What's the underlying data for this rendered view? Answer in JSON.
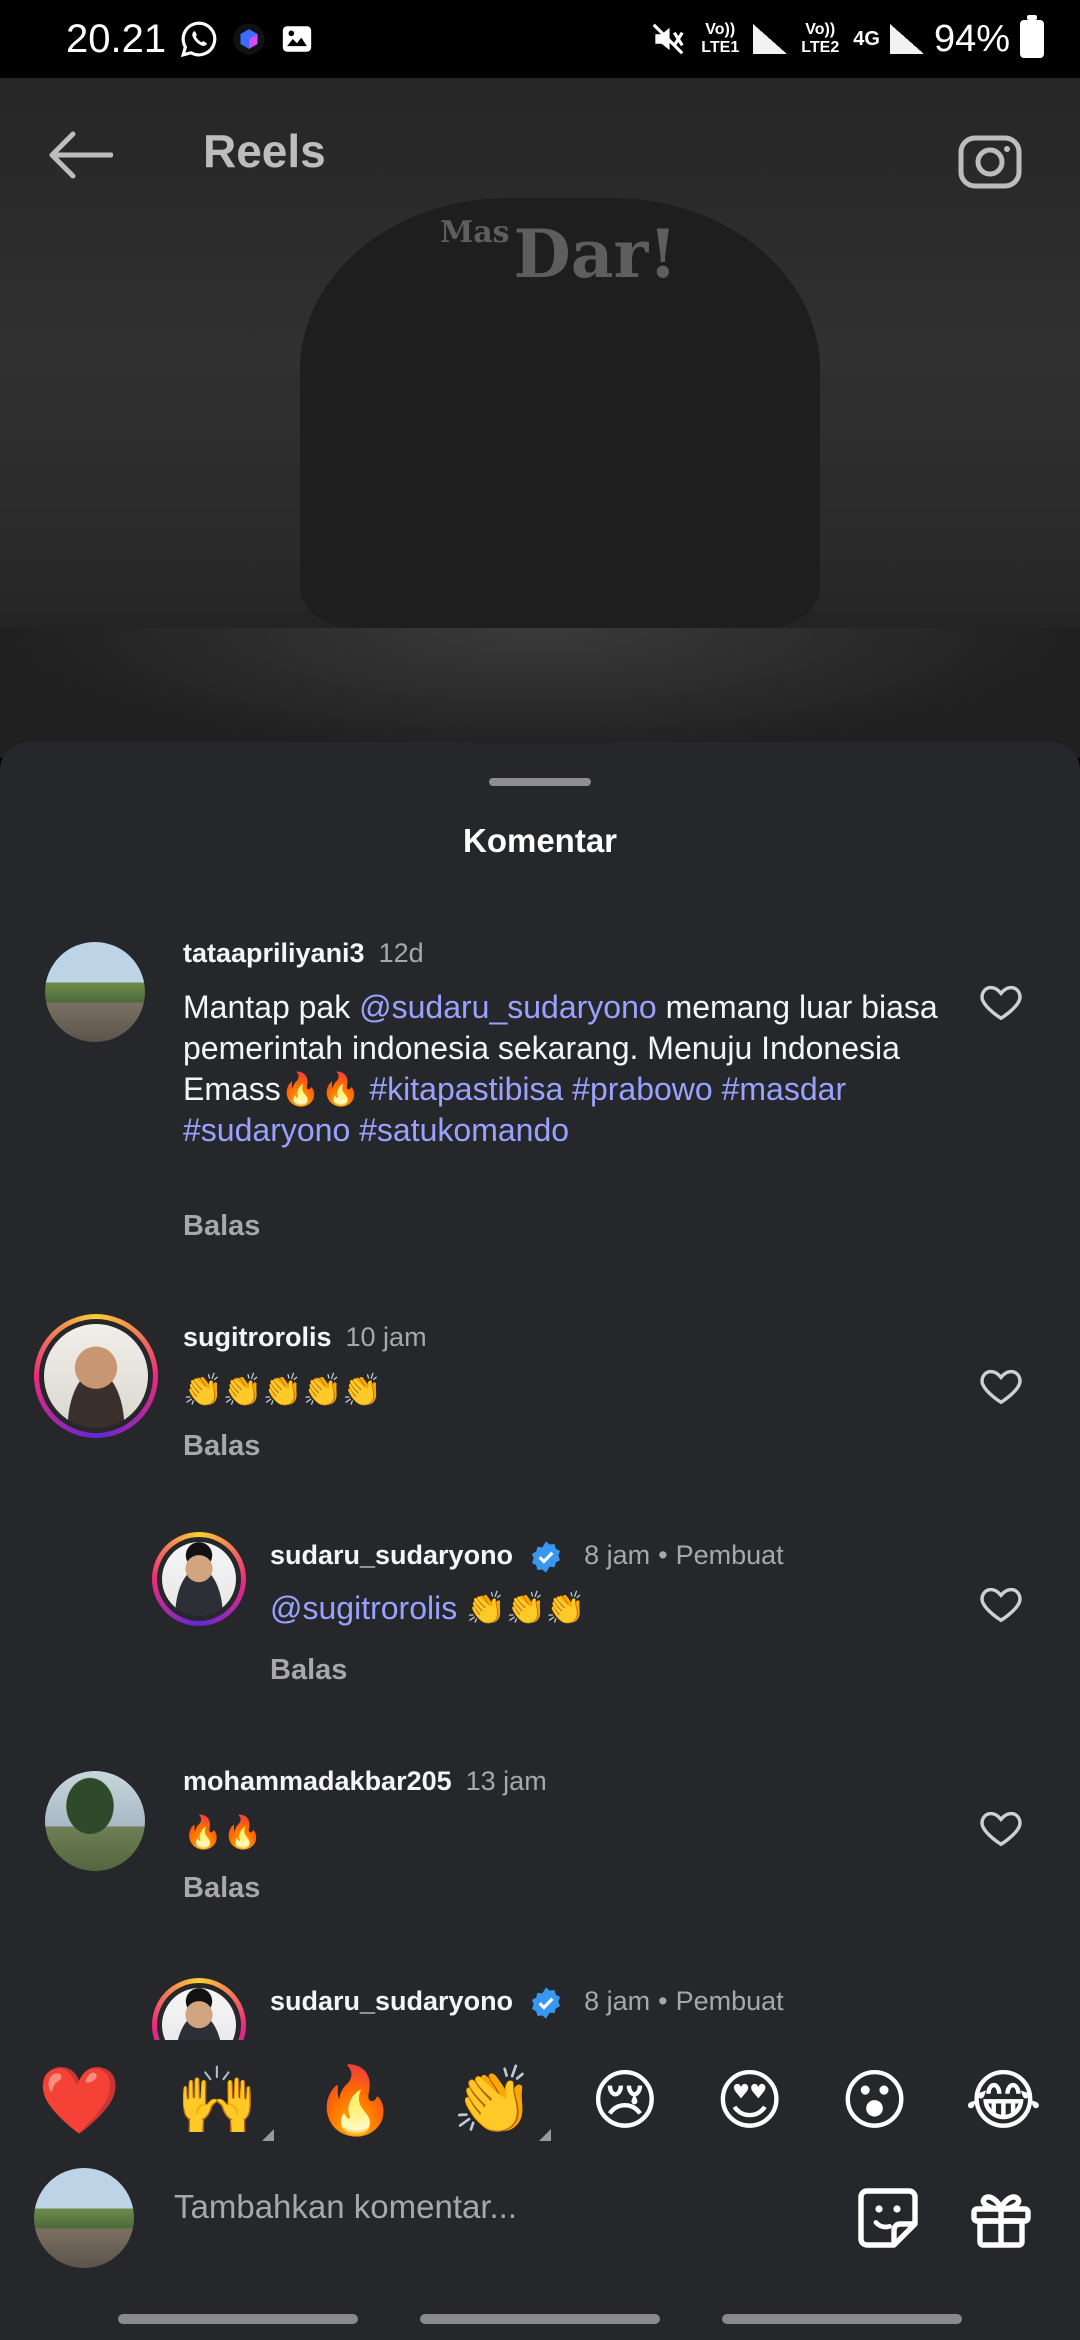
{
  "status_bar": {
    "time": "20.21",
    "sim1": "Vo)) LTE1",
    "sim2": "Vo)) LTE2",
    "network": "4G",
    "battery": "94%"
  },
  "header": {
    "title": "Reels"
  },
  "video": {
    "overlay_logo_small": "Mas",
    "overlay_logo_big": "Dar!"
  },
  "sheet": {
    "title": "Komentar"
  },
  "comments": [
    {
      "username": "tataapriliyani3",
      "time": "12d",
      "parts": [
        {
          "t": "Mantap pak ",
          "link": false
        },
        {
          "t": "@sudaru_sudaryono",
          "link": true
        },
        {
          "t": " memang luar biasa pemerintah indonesia sekarang. Menuju Indonesia Emass🔥🔥 ",
          "link": false
        },
        {
          "t": "#kitapastibisa",
          "link": true
        },
        {
          "t": " ",
          "link": false
        },
        {
          "t": "#prabowo",
          "link": true
        },
        {
          "t": " ",
          "link": false
        },
        {
          "t": "#masdar",
          "link": true
        },
        {
          "t": " ",
          "link": false
        },
        {
          "t": "#sudaryono",
          "link": true
        },
        {
          "t": " ",
          "link": false
        },
        {
          "t": "#satukomando",
          "link": true
        }
      ],
      "reply": "Balas"
    },
    {
      "username": "sugitrorolis",
      "time": "10 jam",
      "text": "👏👏👏👏👏",
      "reply": "Balas"
    },
    {
      "username": "sudaru_sudaryono",
      "time": "8 jam",
      "creator": "Pembuat",
      "mention": "@sugitrorolis",
      "text": " 👏👏👏",
      "reply": "Balas"
    },
    {
      "username": "mohammadakbar205",
      "time": "13 jam",
      "text": "🔥🔥",
      "reply": "Balas"
    },
    {
      "username": "sudaru_sudaryono",
      "time": "8 jam",
      "creator": "Pembuat"
    }
  ],
  "reactions": [
    "❤️",
    "🙌",
    "🔥",
    "👏",
    "😢",
    "😍",
    "😮",
    "😂"
  ],
  "composer": {
    "placeholder": "Tambahkan komentar..."
  },
  "colors": {
    "sheet_bg": "#25272b",
    "link": "#9aa2ff",
    "verified": "#3897f0"
  }
}
